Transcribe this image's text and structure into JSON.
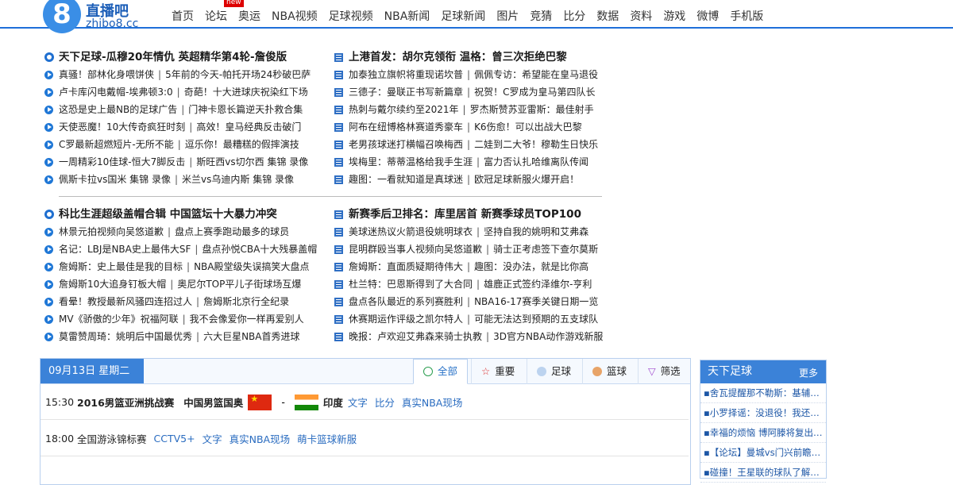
{
  "logo": {
    "digit": "8",
    "cn": "直播吧",
    "domain": "zhibo8.cc"
  },
  "nav": {
    "items": [
      "首页",
      "论坛",
      "奥运",
      "NBA视频",
      "足球视频",
      "NBA新闻",
      "足球新闻",
      "图片",
      "竞猜",
      "比分",
      "数据",
      "资料",
      "游戏",
      "微博",
      "手机版"
    ],
    "badge": "new"
  },
  "news": {
    "soccer": {
      "headline": "天下足球-瓜穆20年情仇  英超精华第4轮-詹俊版",
      "rows": [
        [
          "真骚！部林化身喂饼侠",
          "5年前的今天-帕托开场24秒破巴萨"
        ],
        [
          "卢卡库闪电戴帽-埃弗顿3:0",
          "奇葩！十大进球庆祝染红下场"
        ],
        [
          "这恐是史上最NB的足球广告",
          "门神卡恩长篇逆天扑救合集"
        ],
        [
          "天使恶魔！10大传奇疯狂时刻",
          "高效！皇马经典反击破门"
        ],
        [
          "C罗最新超燃短片-无所不能",
          "逗乐你！最糟糕的假摔演技"
        ],
        [
          "一周精彩10佳球-恒大7脚反击",
          "斯旺西vs切尔西 集锦 录像"
        ],
        [
          "佩斯卡拉vs国米 集锦 录像",
          "米兰vs乌迪内斯 集锦 录像"
        ]
      ]
    },
    "soccer_news": {
      "headline": "上港首发：胡尔克领衔  温格：曾三次拒绝巴黎",
      "rows": [
        [
          "加泰独立旗帜将重现诺坎普",
          "佩佩专访：希望能在皇马退役"
        ],
        [
          "三德子：曼联正书写新篇章",
          "祝贺！C罗成为皇马第四队长"
        ],
        [
          "热刺与戴尔续约至2021年",
          "罗杰斯赞苏亚雷斯：最佳射手"
        ],
        [
          "阿布在纽博格林赛道秀豪车",
          "K6伤愈！可以出战大巴黎"
        ],
        [
          "老男孩球迷打横幅召唤梅西",
          "二娃到二大爷！穆勒生日快乐"
        ],
        [
          "埃梅里：蒂蒂温格给我手生涯",
          "富力否认扎哈维离队传闻"
        ],
        [
          "趣图：一看就知道是真球迷",
          "欧冠足球新服火爆开启！"
        ]
      ]
    },
    "basketball": {
      "headline": "科比生涯超级盖帽合辑  中国篮坛十大暴力冲突",
      "rows": [
        [
          "林景元拍视频向吴悠道歉",
          "盘点上赛季跑动最多的球员"
        ],
        [
          "名记：LBJ是NBA史上最伟大SF",
          "盘点孙悦CBA十大残暴盖帽"
        ],
        [
          "詹姆斯：史上最佳是我的目标",
          "NBA殿堂级失误搞笑大盘点"
        ],
        [
          "詹姆斯10大追身钉板大帽",
          "奥尼尔TOP平儿子街球场互爆"
        ],
        [
          "看晕！教授最新风骚四连招过人",
          "詹姆斯北京行全纪录"
        ],
        [
          "MV《骄傲的少年》祝福阿联",
          "我不会像爱你一样再爱别人"
        ],
        [
          "莫雷赞周琦：姚明后中国最优秀",
          "六大巨星NBA首秀进球"
        ]
      ]
    },
    "nba_news": {
      "headline": "新赛季后卫排名：库里居首  新赛季球员TOP100",
      "rows": [
        [
          "美球迷热议火箭退役姚明球衣",
          "坚持自我的姚明和艾弗森"
        ],
        [
          "昆明群殴当事人视频向吴悠道歉",
          "骑士正考虑签下查尔莫斯"
        ],
        [
          "詹姆斯：直面质疑期待伟大",
          "趣图：没办法，就是比你高"
        ],
        [
          "杜兰特：巴恩斯得到了大合同",
          "雄鹿正式签约泽维尔-亨利"
        ],
        [
          "盘点各队最近的系列赛胜利",
          "NBA16-17赛季关键日期一览"
        ],
        [
          "休赛期运作评级之凯尔特人",
          "可能无法达到预期的五支球队"
        ],
        [
          "晚报：卢欢迎艾弗森来骑士执教",
          "3D官方NBA动作游戏新服"
        ]
      ]
    }
  },
  "schedule": {
    "date": "09月13日 星期二",
    "tabs": [
      "全部",
      "重要",
      "足球",
      "篮球",
      "筛选"
    ],
    "matches": [
      {
        "time": "15:30",
        "title": "2016男篮亚洲挑战赛",
        "home": "中国男篮国奥",
        "dash": "-",
        "away": "印度",
        "links": [
          "文字",
          "比分",
          "真实NBA现场"
        ]
      },
      {
        "time": "18:00",
        "title": "全国游泳锦标赛",
        "links": [
          "CCTV5+",
          "文字",
          "真实NBA现场",
          "萌卡篮球新服"
        ]
      }
    ]
  },
  "sidebar": {
    "title": "天下足球",
    "more": "更多",
    "items": [
      "▪舍瓦提醒那不勒斯：基辅迪纳摩",
      "▪小罗择谣：没退役！我还在踢球",
      "▪幸福的烦恼 博阿滕将复出回归",
      "▪【论坛】曼城vs门兴前瞻分析",
      "▪碰撞！王星联的球队了解不多"
    ]
  }
}
